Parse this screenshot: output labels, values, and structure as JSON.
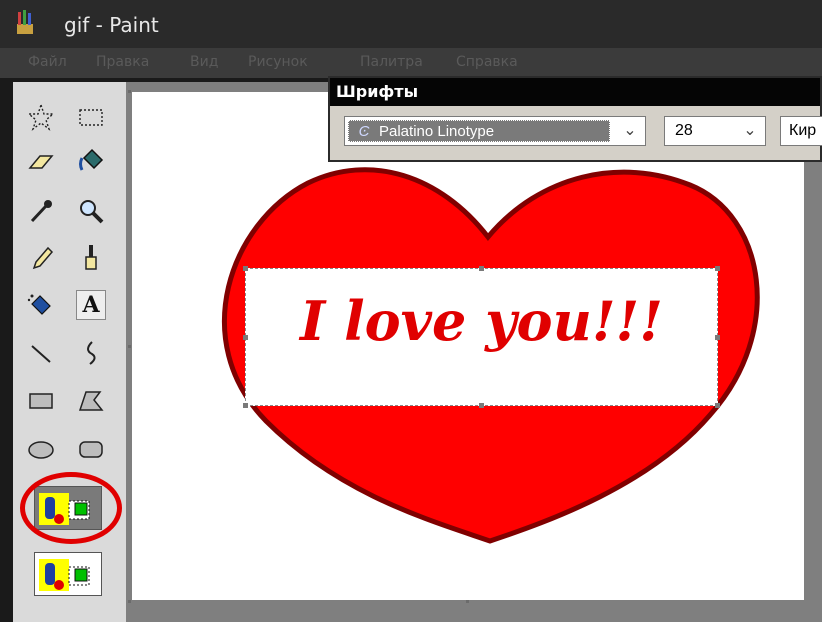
{
  "window": {
    "title": "gif - Paint"
  },
  "menu": {
    "items": [
      "Файл",
      "Правка",
      "Вид",
      "Рисунок",
      "Палитра",
      "Справка"
    ]
  },
  "tools": [
    {
      "name": "free-select"
    },
    {
      "name": "rect-select"
    },
    {
      "name": "eraser"
    },
    {
      "name": "fill"
    },
    {
      "name": "color-picker"
    },
    {
      "name": "magnifier"
    },
    {
      "name": "pencil"
    },
    {
      "name": "brush"
    },
    {
      "name": "airbrush"
    },
    {
      "name": "text"
    },
    {
      "name": "line"
    },
    {
      "name": "curve"
    },
    {
      "name": "rectangle"
    },
    {
      "name": "polygon"
    },
    {
      "name": "ellipse"
    },
    {
      "name": "rounded-rectangle"
    }
  ],
  "text_tool": {
    "label": "A"
  },
  "canvas": {
    "text": "I love you!!!"
  },
  "fonts_toolbar": {
    "title": "Шрифты",
    "font_name": "Palatino Linotype",
    "font_icon": "Ͼ",
    "size": "28",
    "script": "Кир"
  },
  "colors": {
    "heart_fill": "#ff0000",
    "heart_outline": "#800000",
    "text": "#e00000",
    "highlight_ring": "#e00000"
  }
}
